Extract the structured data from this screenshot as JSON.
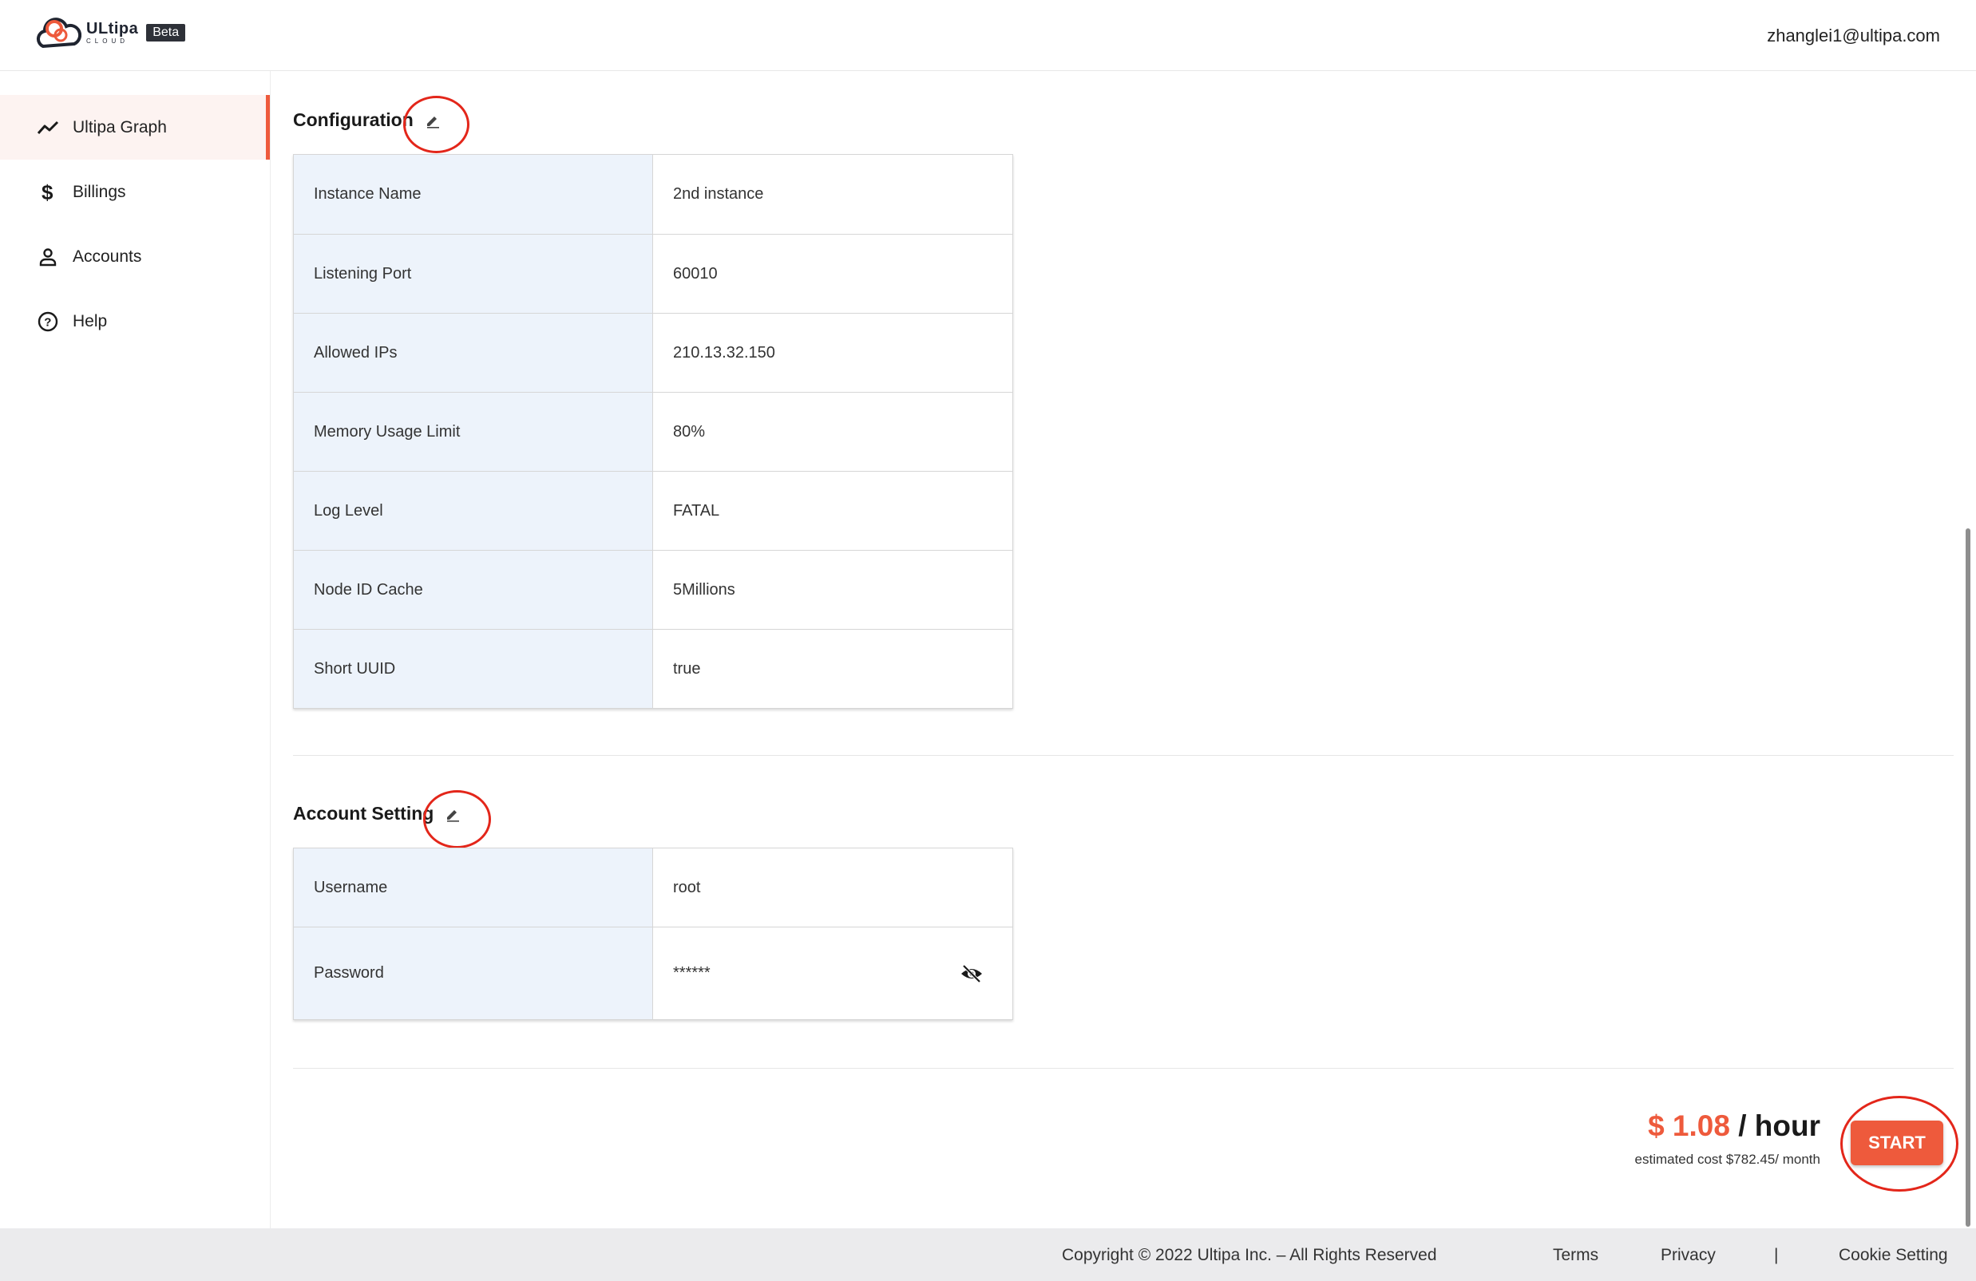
{
  "header": {
    "logo_word": "ULtipa",
    "logo_sub": "CLOUD",
    "beta_badge": "Beta",
    "user_email": "zhanglei1@ultipa.com"
  },
  "sidebar": {
    "items": [
      {
        "label": "Ultipa Graph",
        "icon": "trending-line-icon",
        "active": true
      },
      {
        "label": "Billings",
        "icon": "dollar-icon",
        "active": false
      },
      {
        "label": "Accounts",
        "icon": "person-icon",
        "active": false
      },
      {
        "label": "Help",
        "icon": "help-circle-icon",
        "active": false
      }
    ]
  },
  "configuration": {
    "title": "Configuration",
    "rows": [
      {
        "key": "Instance Name",
        "value": "2nd instance"
      },
      {
        "key": "Listening Port",
        "value": "60010"
      },
      {
        "key": "Allowed IPs",
        "value": "210.13.32.150"
      },
      {
        "key": "Memory Usage Limit",
        "value": "80%"
      },
      {
        "key": "Log Level",
        "value": "FATAL"
      },
      {
        "key": "Node ID Cache",
        "value": "5Millions"
      },
      {
        "key": "Short UUID",
        "value": "true"
      }
    ]
  },
  "account_setting": {
    "title": "Account Setting",
    "rows": [
      {
        "key": "Username",
        "value": "root"
      },
      {
        "key": "Password",
        "value": "******"
      }
    ]
  },
  "pricing": {
    "amount": "$ 1.08",
    "unit": " / hour",
    "estimate": "estimated cost $782.45/ month",
    "start_label": "START"
  },
  "footer": {
    "copyright": "Copyright © 2022 Ultipa Inc. – All Rights Reserved",
    "terms": "Terms",
    "privacy": "Privacy",
    "separator": "|",
    "cookie": "Cookie Setting"
  },
  "colors": {
    "accent": "#ee5a3c",
    "annotation_circle": "#e3261a",
    "key_cell_bg": "#edf3fb"
  }
}
